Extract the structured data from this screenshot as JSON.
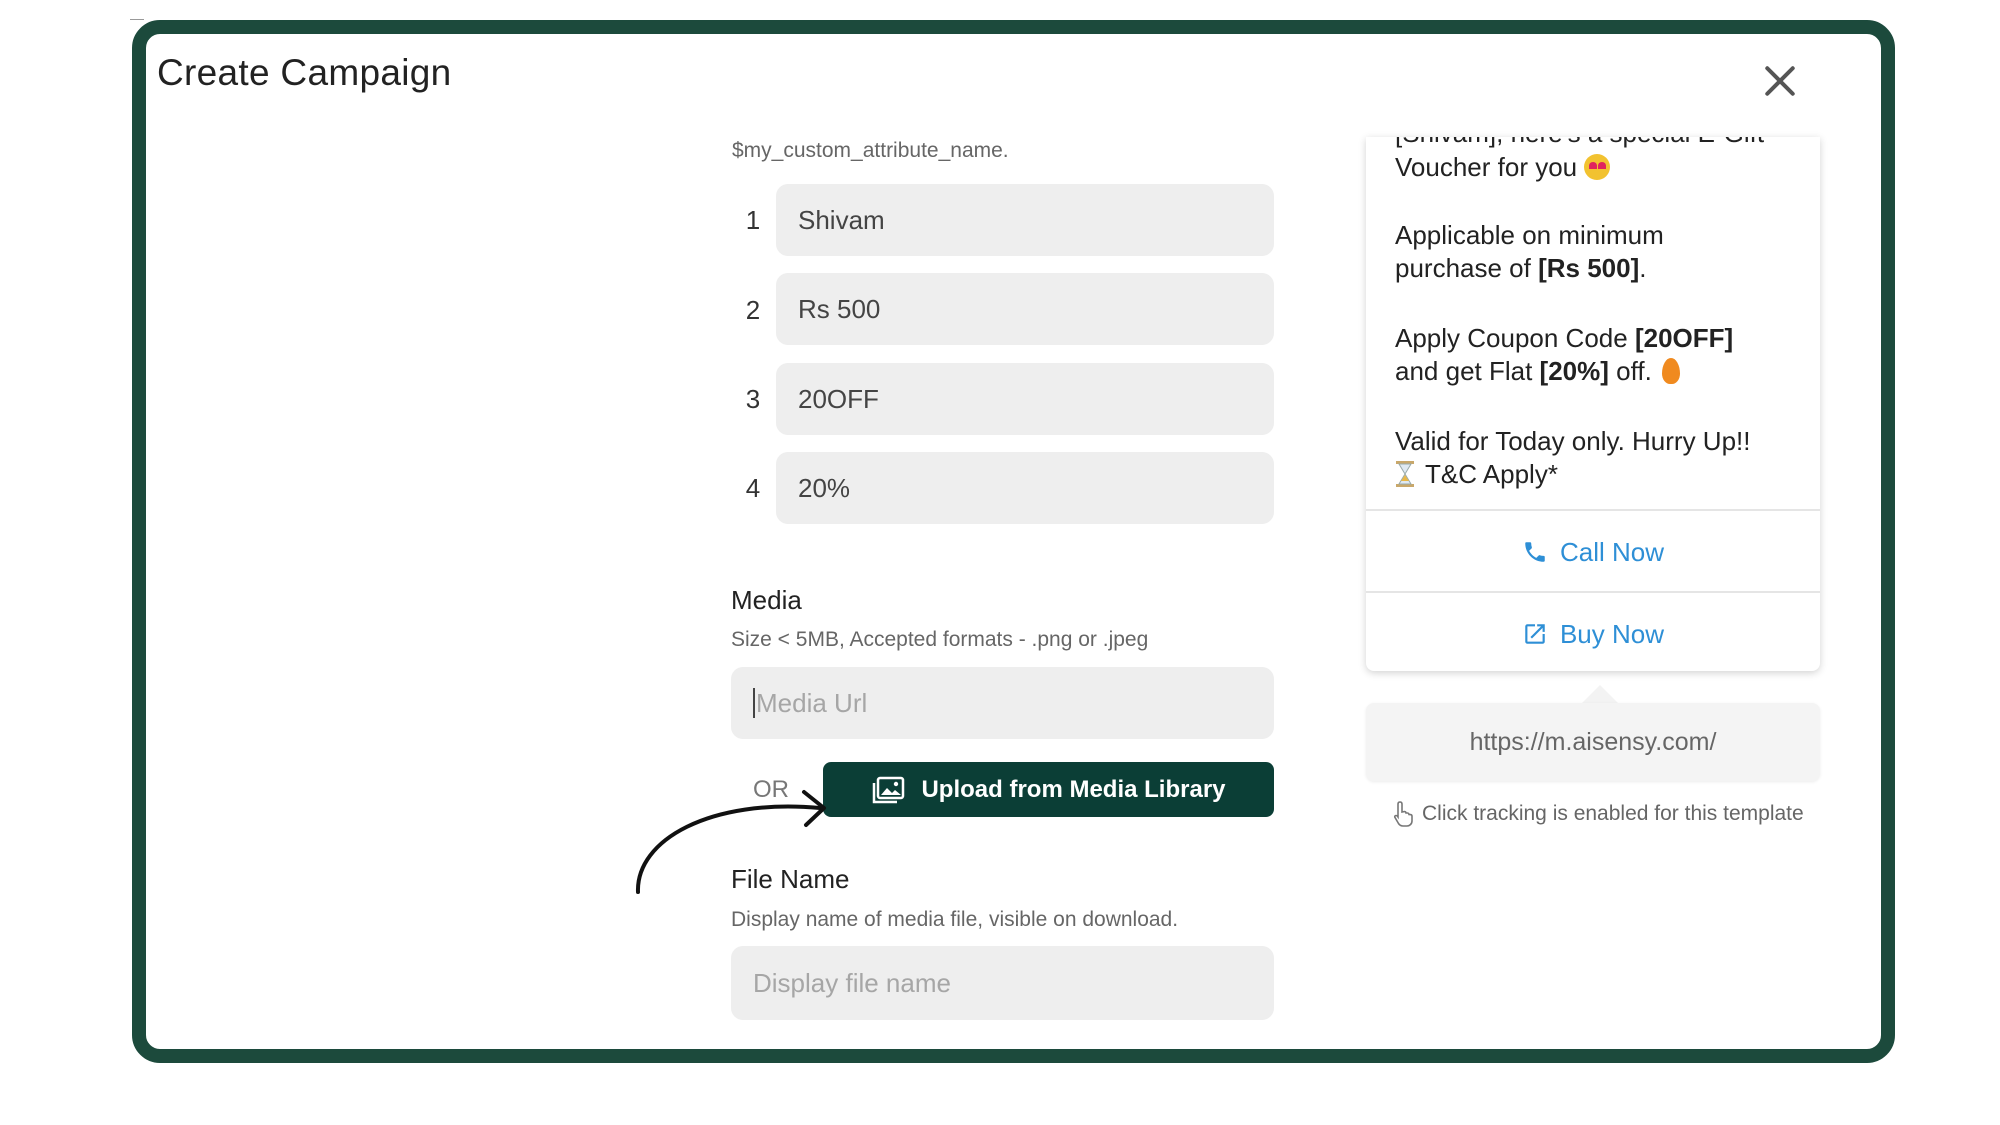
{
  "modal": {
    "title": "Create Campaign",
    "close_label": "close"
  },
  "variables": {
    "hint": "$my_custom_attribute_name.",
    "items": [
      {
        "index": "1",
        "value": "Shivam"
      },
      {
        "index": "2",
        "value": "Rs 500"
      },
      {
        "index": "3",
        "value": "20OFF"
      },
      {
        "index": "4",
        "value": "20%"
      }
    ]
  },
  "media": {
    "label": "Media",
    "hint": "Size < 5MB, Accepted formats - .png or .jpeg",
    "url_placeholder": "Media Url",
    "or_label": "OR",
    "upload_label": "Upload from Media Library"
  },
  "file_name": {
    "label": "File Name",
    "hint": "Display name of media file, visible on download.",
    "placeholder": "Display file name"
  },
  "preview": {
    "cut_line": "[Shivam], here's a special E-Gift",
    "line_voucher": "Voucher for you",
    "line_min_1": "Applicable on minimum",
    "line_min_2_prefix": "purchase of ",
    "line_min_2_bold": "[Rs 500]",
    "line_min_2_suffix": ".",
    "line_coupon_1_prefix": "Apply Coupon Code ",
    "line_coupon_1_bold": "[20OFF]",
    "line_coupon_2_prefix": "and get Flat ",
    "line_coupon_2_bold": "[20%]",
    "line_coupon_2_suffix": " off.",
    "line_valid_1": "Valid for Today only. Hurry Up!!",
    "line_valid_2": "T&C Apply*",
    "buttons": [
      {
        "label": "Call Now",
        "icon": "phone-icon"
      },
      {
        "label": "Buy Now",
        "icon": "external-link-icon"
      }
    ],
    "url": "https://m.aisensy.com/",
    "tracking_note": "Click tracking is enabled for this template"
  },
  "colors": {
    "frame": "#1c4a3c",
    "primary_button": "#0b3e36",
    "link_blue": "#2e8fd6"
  }
}
